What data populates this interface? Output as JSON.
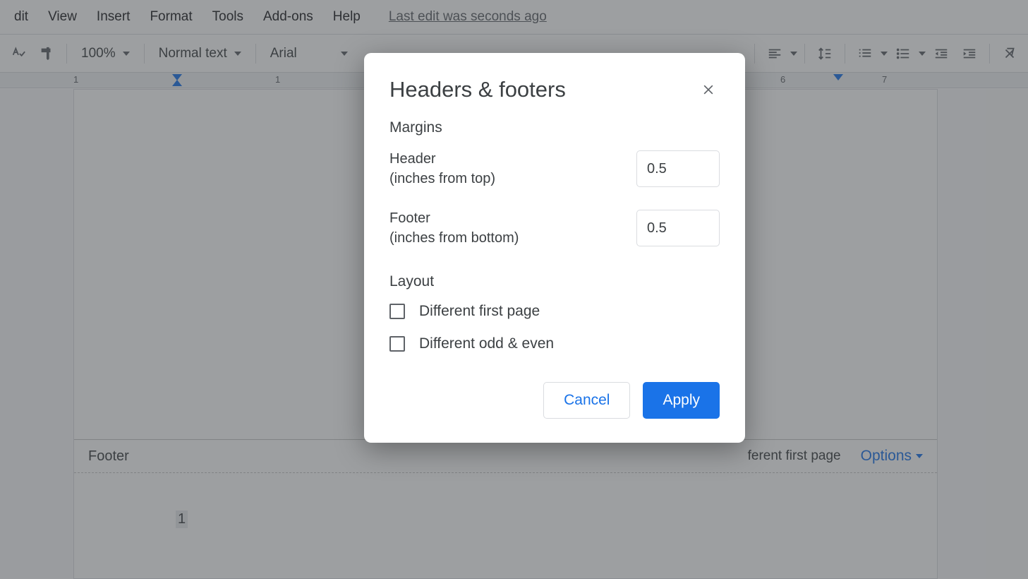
{
  "menubar": {
    "items": [
      {
        "label": "dit"
      },
      {
        "label": "View"
      },
      {
        "label": "Insert"
      },
      {
        "label": "Format"
      },
      {
        "label": "Tools"
      },
      {
        "label": "Add-ons"
      },
      {
        "label": "Help"
      }
    ],
    "last_edit": "Last edit was seconds ago"
  },
  "toolbar": {
    "zoom": "100%",
    "style": "Normal text",
    "font": "Arial"
  },
  "ruler": {
    "numbers": [
      "1",
      "1",
      "6",
      "7"
    ]
  },
  "footer": {
    "label": "Footer",
    "different_label": "ferent first page",
    "options_label": "Options",
    "page_number": "1"
  },
  "dialog": {
    "title": "Headers & footers",
    "sections": {
      "margins_label": "Margins",
      "header_label": "Header",
      "header_sub": "(inches from top)",
      "header_value": "0.5",
      "footer_label": "Footer",
      "footer_sub": "(inches from bottom)",
      "footer_value": "0.5",
      "layout_label": "Layout",
      "diff_first": "Different first page",
      "diff_odd_even": "Different odd & even"
    },
    "buttons": {
      "cancel": "Cancel",
      "apply": "Apply"
    }
  }
}
